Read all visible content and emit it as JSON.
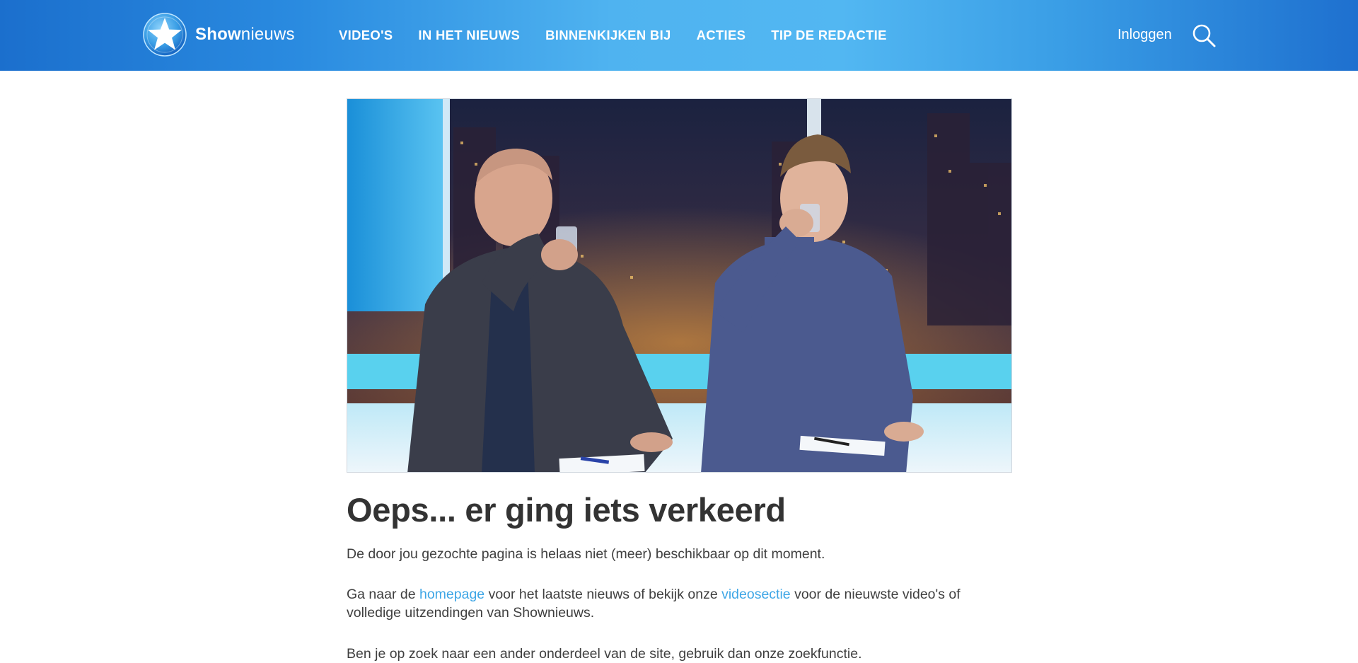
{
  "header": {
    "logo": {
      "bold": "Show",
      "light": "nieuws"
    },
    "nav": [
      "VIDEO'S",
      "IN HET NIEUWS",
      "BINNENKIJKEN BIJ",
      "ACTIES",
      "TIP DE REDACTIE"
    ],
    "login_label": "Inloggen",
    "search_icon": "search-icon"
  },
  "hero": {
    "image": "two-presenters-drinking-water-studio"
  },
  "error": {
    "title": "Oeps... er ging iets verkeerd",
    "p1": "De door jou gezochte pagina is helaas niet (meer) beschikbaar op dit moment.",
    "p2_before": "Ga naar de ",
    "p2_link1": "homepage",
    "p2_mid": " voor het laatste nieuws of bekijk onze ",
    "p2_link2": "videosectie",
    "p2_after": " voor de nieuwste video's of volledige uitzendingen van Shownieuws.",
    "p3": "Ben je op zoek naar een ander onderdeel van de site, gebruik dan onze zoekfunctie."
  },
  "colors": {
    "brand_blue": "#1b6fcd",
    "link_blue": "#3ea6e6",
    "heading": "#333333"
  }
}
